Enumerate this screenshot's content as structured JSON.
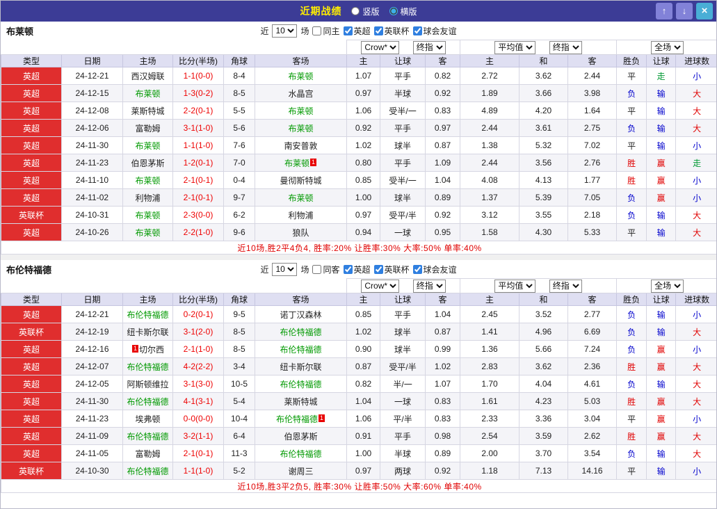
{
  "topbar": {
    "title": "近期战绩",
    "vertical_label": "竖版",
    "horizontal_label": "横版",
    "up_icon": "↑",
    "down_icon": "↓",
    "close_icon": "×"
  },
  "table_headers": {
    "type": "类型",
    "date": "日期",
    "home": "主场",
    "score": "比分(半场)",
    "corner": "角球",
    "away": "客场",
    "odds_home": "主",
    "odds_handicap": "让球",
    "odds_away": "客",
    "avg_home": "主",
    "avg_draw": "和",
    "avg_away": "客",
    "res_wdl": "胜负",
    "res_handicap": "让球",
    "res_goals": "进球数"
  },
  "table_controls": {
    "company": "Crow*",
    "final": "终指",
    "average": "平均值",
    "scope": "全场"
  },
  "colors": {
    "accent_bar": "#3c3c96",
    "league_red": "#e02e2e",
    "focus_green": "#009900",
    "win_red": "#e00000",
    "lose_blue": "#0000cc",
    "push_green": "#009933"
  },
  "sections": [
    {
      "team": "布莱顿",
      "filters": {
        "near": "近",
        "count": "10",
        "games": "场",
        "same": "同主",
        "l1": "英超",
        "l2": "英联杯",
        "l3": "球会友谊"
      },
      "rows": [
        {
          "c": [
            "英超",
            "24-12-21",
            "西汉姆联",
            "1-1(0-0)",
            "8-4",
            "布莱顿",
            "1.07",
            "平手",
            "0.82",
            "2.72",
            "3.62",
            "2.44",
            "平",
            "走",
            "小"
          ]
        },
        {
          "c": [
            "英超",
            "24-12-15",
            "布莱顿",
            "1-3(0-2)",
            "8-5",
            "水晶宫",
            "0.97",
            "半球",
            "0.92",
            "1.89",
            "3.66",
            "3.98",
            "负",
            "输",
            "大"
          ]
        },
        {
          "c": [
            "英超",
            "24-12-08",
            "莱斯特城",
            "2-2(0-1)",
            "5-5",
            "布莱顿",
            "1.06",
            "受半/一",
            "0.83",
            "4.89",
            "4.20",
            "1.64",
            "平",
            "输",
            "大"
          ]
        },
        {
          "c": [
            "英超",
            "24-12-06",
            "富勒姆",
            "3-1(1-0)",
            "5-6",
            "布莱顿",
            "0.92",
            "平手",
            "0.97",
            "2.44",
            "3.61",
            "2.75",
            "负",
            "输",
            "大"
          ]
        },
        {
          "c": [
            "英超",
            "24-11-30",
            "布莱顿",
            "1-1(1-0)",
            "7-6",
            "南安普敦",
            "1.02",
            "球半",
            "0.87",
            "1.38",
            "5.32",
            "7.02",
            "平",
            "输",
            "小"
          ]
        },
        {
          "c": [
            "英超",
            "24-11-23",
            "伯恩茅斯",
            "1-2(0-1)",
            "7-0",
            "布莱顿",
            "0.80",
            "平手",
            "1.09",
            "2.44",
            "3.56",
            "2.76",
            "胜",
            "赢",
            "走"
          ],
          "away_card": "1"
        },
        {
          "c": [
            "英超",
            "24-11-10",
            "布莱顿",
            "2-1(0-1)",
            "0-4",
            "曼彻斯特城",
            "0.85",
            "受半/一",
            "1.04",
            "4.08",
            "4.13",
            "1.77",
            "胜",
            "赢",
            "小"
          ]
        },
        {
          "c": [
            "英超",
            "24-11-02",
            "利物浦",
            "2-1(0-1)",
            "9-7",
            "布莱顿",
            "1.00",
            "球半",
            "0.89",
            "1.37",
            "5.39",
            "7.05",
            "负",
            "赢",
            "小"
          ]
        },
        {
          "c": [
            "英联杯",
            "24-10-31",
            "布莱顿",
            "2-3(0-0)",
            "6-2",
            "利物浦",
            "0.97",
            "受平/半",
            "0.92",
            "3.12",
            "3.55",
            "2.18",
            "负",
            "输",
            "大"
          ]
        },
        {
          "c": [
            "英超",
            "24-10-26",
            "布莱顿",
            "2-2(1-0)",
            "9-6",
            "狼队",
            "0.94",
            "一球",
            "0.95",
            "1.58",
            "4.30",
            "5.33",
            "平",
            "输",
            "大"
          ]
        }
      ],
      "summary": "近10场,胜2平4负4, 胜率:20% 让胜率:30% 大率:50% 单率:40%"
    },
    {
      "team": "布伦特福德",
      "filters": {
        "near": "近",
        "count": "10",
        "games": "场",
        "same": "同客",
        "l1": "英超",
        "l2": "英联杯",
        "l3": "球会友谊"
      },
      "rows": [
        {
          "c": [
            "英超",
            "24-12-21",
            "布伦特福德",
            "0-2(0-1)",
            "9-5",
            "诺丁汉森林",
            "0.85",
            "平手",
            "1.04",
            "2.45",
            "3.52",
            "2.77",
            "负",
            "输",
            "小"
          ]
        },
        {
          "c": [
            "英联杯",
            "24-12-19",
            "纽卡斯尔联",
            "3-1(2-0)",
            "8-5",
            "布伦特福德",
            "1.02",
            "球半",
            "0.87",
            "1.41",
            "4.96",
            "6.69",
            "负",
            "输",
            "大"
          ]
        },
        {
          "c": [
            "英超",
            "24-12-16",
            "切尔西",
            "2-1(1-0)",
            "8-5",
            "布伦特福德",
            "0.90",
            "球半",
            "0.99",
            "1.36",
            "5.66",
            "7.24",
            "负",
            "赢",
            "小"
          ],
          "home_card": "1",
          "home_card_pos": "before"
        },
        {
          "c": [
            "英超",
            "24-12-07",
            "布伦特福德",
            "4-2(2-2)",
            "3-4",
            "纽卡斯尔联",
            "0.87",
            "受平/半",
            "1.02",
            "2.83",
            "3.62",
            "2.36",
            "胜",
            "赢",
            "大"
          ]
        },
        {
          "c": [
            "英超",
            "24-12-05",
            "阿斯顿维拉",
            "3-1(3-0)",
            "10-5",
            "布伦特福德",
            "0.82",
            "半/一",
            "1.07",
            "1.70",
            "4.04",
            "4.61",
            "负",
            "输",
            "大"
          ]
        },
        {
          "c": [
            "英超",
            "24-11-30",
            "布伦特福德",
            "4-1(3-1)",
            "5-4",
            "莱斯特城",
            "1.04",
            "一球",
            "0.83",
            "1.61",
            "4.23",
            "5.03",
            "胜",
            "赢",
            "大"
          ]
        },
        {
          "c": [
            "英超",
            "24-11-23",
            "埃弗顿",
            "0-0(0-0)",
            "10-4",
            "布伦特福德",
            "1.06",
            "平/半",
            "0.83",
            "2.33",
            "3.36",
            "3.04",
            "平",
            "赢",
            "小"
          ],
          "away_card": "1"
        },
        {
          "c": [
            "英超",
            "24-11-09",
            "布伦特福德",
            "3-2(1-1)",
            "6-4",
            "伯恩茅斯",
            "0.91",
            "平手",
            "0.98",
            "2.54",
            "3.59",
            "2.62",
            "胜",
            "赢",
            "大"
          ]
        },
        {
          "c": [
            "英超",
            "24-11-05",
            "富勒姆",
            "2-1(0-1)",
            "11-3",
            "布伦特福德",
            "1.00",
            "半球",
            "0.89",
            "2.00",
            "3.70",
            "3.54",
            "负",
            "输",
            "大"
          ]
        },
        {
          "c": [
            "英联杯",
            "24-10-30",
            "布伦特福德",
            "1-1(1-0)",
            "5-2",
            "谢周三",
            "0.97",
            "两球",
            "0.92",
            "1.18",
            "7.13",
            "14.16",
            "平",
            "输",
            "小"
          ]
        }
      ],
      "summary": "近10场,胜3平2负5, 胜率:30% 让胜率:50% 大率:60% 单率:40%"
    }
  ]
}
